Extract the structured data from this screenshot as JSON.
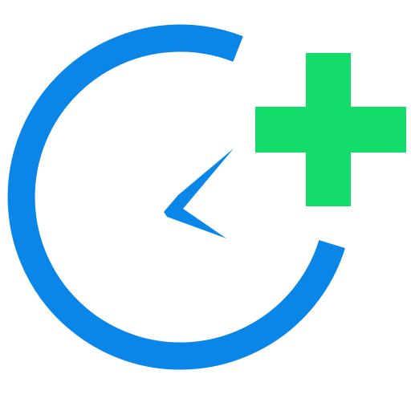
{
  "icon": {
    "semantic": "add-clock-icon",
    "parts": [
      "clock-ring-icon",
      "clock-hands-icon",
      "plus-icon"
    ]
  },
  "colors": {
    "background": "#FFFFFF",
    "clock": "#0A86E8",
    "plus": "#14DC6A"
  }
}
